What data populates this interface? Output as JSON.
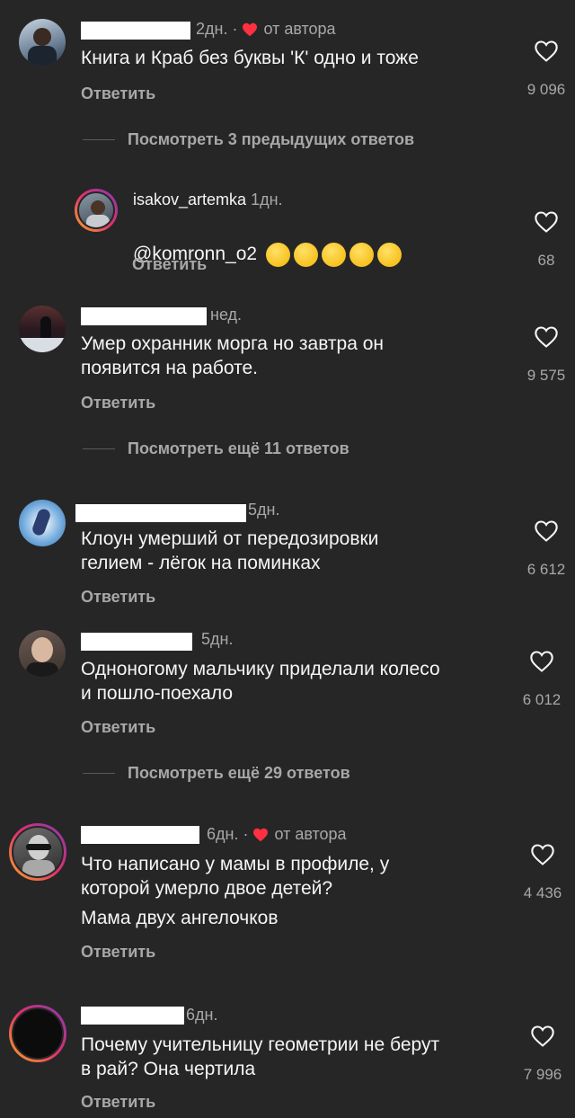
{
  "comments": [
    {
      "time": "2дн. ·",
      "author_badge": "от автора",
      "text": "Книга и Краб без буквы 'К' одно и тоже",
      "reply_label": "Ответить",
      "likes": "9 096",
      "more_replies": "Посмотреть 3 предыдущих ответов"
    },
    {
      "username": "isakov_artemka",
      "time": "1дн.",
      "text": "@komronn_o2",
      "reply_label": "Ответить",
      "likes": "68"
    },
    {
      "time": "нед.",
      "text": "Умер охранник морга но завтра он\nпоявится на работе.",
      "reply_label": "Ответить",
      "likes": "9 575",
      "more_replies": "Посмотреть ещё 11 ответов"
    },
    {
      "time": "5дн.",
      "text": "Клоун умерший от передозировки\nгелием - лёгок на поминках",
      "reply_label": "Ответить",
      "likes": "6 612"
    },
    {
      "time": "5дн.",
      "text": "Одноногому мальчику приделали колесо\nи пошло-поехало",
      "reply_label": "Ответить",
      "likes": "6 012",
      "more_replies": "Посмотреть ещё 29 ответов"
    },
    {
      "time": "6дн. ·",
      "author_badge": "от автора",
      "text": "Что написано у мамы в профиле, у\nкоторой умерло двое детей?",
      "text2": "Мама двух ангелочков",
      "reply_label": "Ответить",
      "likes": "4 436"
    },
    {
      "time": "6дн.",
      "text": "Почему учительницу геометрии не берут\nв рай? Она чертила",
      "reply_label": "Ответить",
      "likes": "7 996"
    }
  ]
}
